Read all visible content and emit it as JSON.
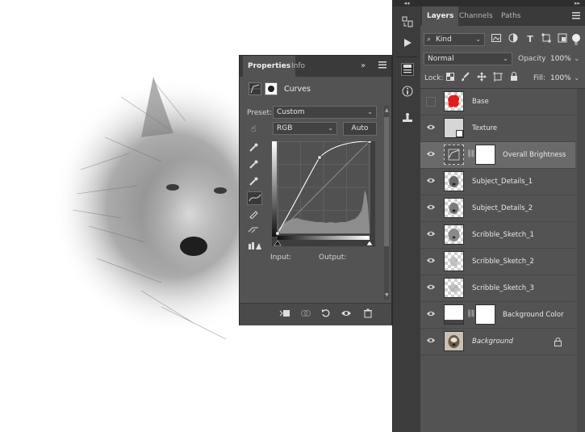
{
  "properties_panel": {
    "tabs": [
      {
        "label": "Properties"
      },
      {
        "label": "Info"
      }
    ],
    "menu_glyph": "»",
    "adjustment_title": "Curves",
    "preset_label": "Preset:",
    "preset_value": "Custom",
    "channel_value": "RGB",
    "auto_label": "Auto",
    "input_label": "Input:",
    "output_label": "Output:"
  },
  "layers_panel": {
    "tabs": [
      {
        "label": "Layers"
      },
      {
        "label": "Channels"
      },
      {
        "label": "Paths"
      }
    ],
    "filter_value": "Kind",
    "blend_mode": "Normal",
    "opacity_label": "Opacity:",
    "opacity_value": "100%",
    "lock_label": "Lock:",
    "fill_label": "Fill:",
    "fill_value": "100%",
    "layers": [
      {
        "name": "Base",
        "visible": false
      },
      {
        "name": "Texture",
        "visible": true
      },
      {
        "name": "Overall Brightness",
        "visible": true,
        "selected": true
      },
      {
        "name": "Subject_Details_1",
        "visible": true
      },
      {
        "name": "Subject_Details_2",
        "visible": true
      },
      {
        "name": "Scribble_Sketch_1",
        "visible": true
      },
      {
        "name": "Scribble_Sketch_2",
        "visible": true
      },
      {
        "name": "Scribble_Sketch_3",
        "visible": true
      },
      {
        "name": "Background Color",
        "visible": true
      },
      {
        "name": "Background",
        "visible": true,
        "italic": true,
        "locked": true
      }
    ]
  },
  "colors": {
    "panel_bg": "#535353",
    "tab_bg": "#3a3a3a",
    "selected_row": "#6a6a6a",
    "base_thumb_accent": "#e11d1d"
  }
}
